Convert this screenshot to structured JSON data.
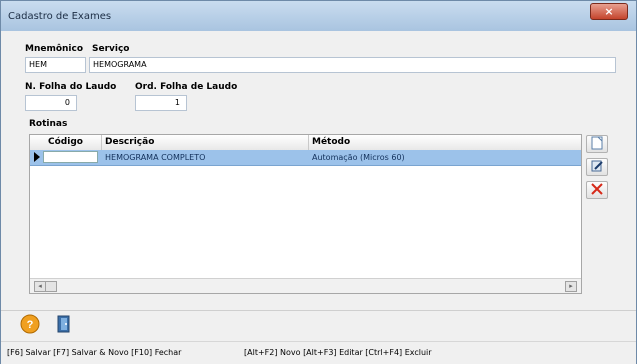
{
  "window": {
    "title": "Cadastro de Exames",
    "close_glyph": "×"
  },
  "form": {
    "mnemonico_label": "Mnemônico",
    "mnemonico_value": "HEM",
    "servico_label": "Serviço",
    "servico_value": "HEMOGRAMA",
    "folha_label": "N. Folha do Laudo",
    "folha_value": "0",
    "ord_folha_label": "Ord. Folha de Laudo",
    "ord_folha_value": "1"
  },
  "rotinas": {
    "label": "Rotinas",
    "columns": [
      "Código",
      "Descrição",
      "Método"
    ],
    "rows": [
      {
        "codigo": "",
        "descricao": "HEMOGRAMA COMPLETO",
        "metodo": "Automação (Micros 60)"
      }
    ]
  },
  "side_buttons": [
    "new-icon",
    "edit-icon",
    "delete-icon"
  ],
  "toolbar_icons": [
    "help-icon",
    "exit-door-icon"
  ],
  "status": {
    "left": "[F6] Salvar [F7] Salvar & Novo [F10] Fechar",
    "right": "[Alt+F2] Novo [Alt+F3] Editar [Ctrl+F4] Excluir"
  },
  "colors": {
    "selection": "#9cc2ea",
    "titlebar": "#b6cde6",
    "close": "#c4442c"
  }
}
